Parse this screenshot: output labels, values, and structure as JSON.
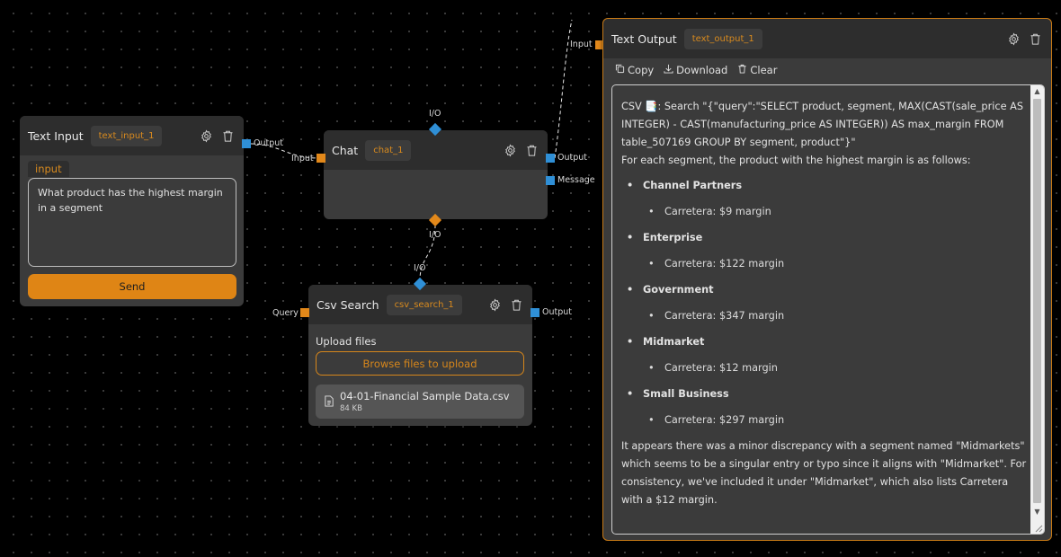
{
  "colors": {
    "accent": "#df8515",
    "port_blue": "#2f8fd6",
    "port_orange": "#e2881a",
    "node_bg": "#3b3b3b",
    "header_bg": "#2d2d2d",
    "canvas_bg": "#000000"
  },
  "icons": {
    "settings": "gear-icon",
    "delete": "trash-icon",
    "copy": "copy-icon",
    "download": "download-icon",
    "clear": "trash-icon",
    "file": "file-icon",
    "doc_emoji": "📑"
  },
  "text_input": {
    "title": "Text Input",
    "id": "text_input_1",
    "field_label": "input",
    "value": "What product has the highest margin in a segment",
    "send_label": "Send",
    "output_port": "Output"
  },
  "chat": {
    "title": "Chat",
    "id": "chat_1",
    "input_port": "Input",
    "top_port": "I/O",
    "bottom_port": "I/O",
    "output_port": "Output",
    "message_port": "Message"
  },
  "csv_search": {
    "title": "Csv Search",
    "id": "csv_search_1",
    "top_port": "I/O",
    "query_port": "Query",
    "output_port": "Output",
    "upload_label": "Upload files",
    "browse_label": "Browse files to upload",
    "file": {
      "name": "04-01-Financial Sample Data.csv",
      "size": "84 KB"
    }
  },
  "text_output": {
    "title": "Text Output",
    "id": "text_output_1",
    "input_port": "Input",
    "toolbar": {
      "copy": "Copy",
      "download": "Download",
      "clear": "Clear"
    },
    "content": {
      "prefix": "CSV ",
      "emoji": "📑",
      "search_line": ": Search \"{\"query\":\"SELECT product, segment, MAX(CAST(sale_price AS INTEGER) - CAST(manufacturing_price AS INTEGER)) AS max_margin FROM table_507169 GROUP BY segment, product\"}\"",
      "intro": "For each segment, the product with the highest margin is as follows:",
      "segments": [
        {
          "name": "Channel Partners",
          "detail": "Carretera: $9 margin"
        },
        {
          "name": "Enterprise",
          "detail": "Carretera: $122 margin"
        },
        {
          "name": "Government",
          "detail": "Carretera: $347 margin"
        },
        {
          "name": "Midmarket",
          "detail": "Carretera: $12 margin"
        },
        {
          "name": "Small Business",
          "detail": "Carretera: $297 margin"
        }
      ],
      "closing": "It appears there was a minor discrepancy with a segment named \"Midmarkets\" which seems to be a singular entry or typo since it aligns with \"Midmarket\". For consistency, we've included it under \"Midmarket\", which also lists Carretera with a $12 margin."
    }
  }
}
